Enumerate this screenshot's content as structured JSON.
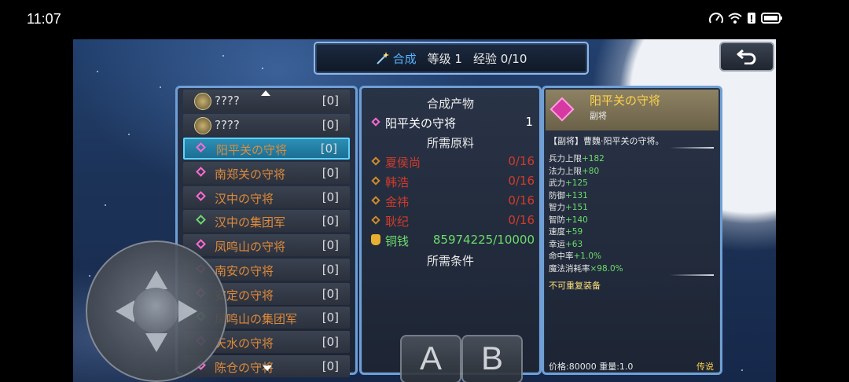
{
  "status_bar": {
    "time": "11:07"
  },
  "header": {
    "craft_label": "合成",
    "level_label": "等级 1",
    "exp_label": "经验 0/10"
  },
  "list": {
    "items": [
      {
        "name": "????",
        "count": "[0]",
        "icon": "coin-icon",
        "unknown": true
      },
      {
        "name": "????",
        "count": "[0]",
        "icon": "coin-icon",
        "unknown": true
      },
      {
        "name": "阳平关の守将",
        "count": "[0]",
        "icon": "pink-diamond-icon",
        "selected": true
      },
      {
        "name": "南郑关の守将",
        "count": "[0]",
        "icon": "pink-diamond-icon"
      },
      {
        "name": "汉中の守将",
        "count": "[0]",
        "icon": "pink-diamond-icon"
      },
      {
        "name": "汉中の集团军",
        "count": "[0]",
        "icon": "rainbow-diamond-icon"
      },
      {
        "name": "凤鸣山の守将",
        "count": "[0]",
        "icon": "pink-diamond-icon"
      },
      {
        "name": "南安の守将",
        "count": "[0]",
        "icon": "pink-diamond-icon"
      },
      {
        "name": "安定の守将",
        "count": "[0]",
        "icon": "pink-diamond-icon"
      },
      {
        "name": "凤鸣山の集团军",
        "count": "[0]",
        "icon": "rainbow-diamond-icon"
      },
      {
        "name": "天水の守将",
        "count": "[0]",
        "icon": "pink-diamond-icon"
      },
      {
        "name": "陈仓の守将",
        "count": "[0]",
        "icon": "pink-diamond-icon"
      }
    ]
  },
  "recipe": {
    "product_heading": "合成产物",
    "product": {
      "name": "阳平关の守将",
      "qty": "1"
    },
    "materials_heading": "所需原料",
    "materials": [
      {
        "name": "夏侯尚",
        "have": "0/16"
      },
      {
        "name": "韩浩",
        "have": "0/16"
      },
      {
        "name": "金祎",
        "have": "0/16"
      },
      {
        "name": "耿纪",
        "have": "0/16"
      }
    ],
    "coin": {
      "name": "铜钱",
      "value": "85974225/10000"
    },
    "conditions_heading": "所需条件"
  },
  "detail": {
    "title": "阳平关の守将",
    "subtitle": "副将",
    "description": "【副将】曹魏·阳平关の守将。",
    "stats": [
      {
        "label": "兵力上限",
        "value": "+182"
      },
      {
        "label": "法力上限",
        "value": "+80"
      },
      {
        "label": "武力",
        "value": "+125"
      },
      {
        "label": "防御",
        "value": "+131"
      },
      {
        "label": "智力",
        "value": "+151"
      },
      {
        "label": "智防",
        "value": "+140"
      },
      {
        "label": "速度",
        "value": "+59"
      },
      {
        "label": "幸运",
        "value": "+63"
      },
      {
        "label": "命中率",
        "value": "+1.0%"
      },
      {
        "label": "魔法消耗率",
        "value": "×98.0%"
      }
    ],
    "no_duplicate": "不可重复装备",
    "price": "价格:80000 重量:1.0",
    "rarity": "传说"
  },
  "buttons": {
    "a": "A",
    "b": "B"
  },
  "colors": {
    "panel_border": "#6f9fd4",
    "selected_row": "#1b6f95",
    "name_orange": "#e08a3a",
    "missing_red": "#d33a2a",
    "ok_green": "#6cdc6c",
    "title_gold": "#ffd24a"
  }
}
